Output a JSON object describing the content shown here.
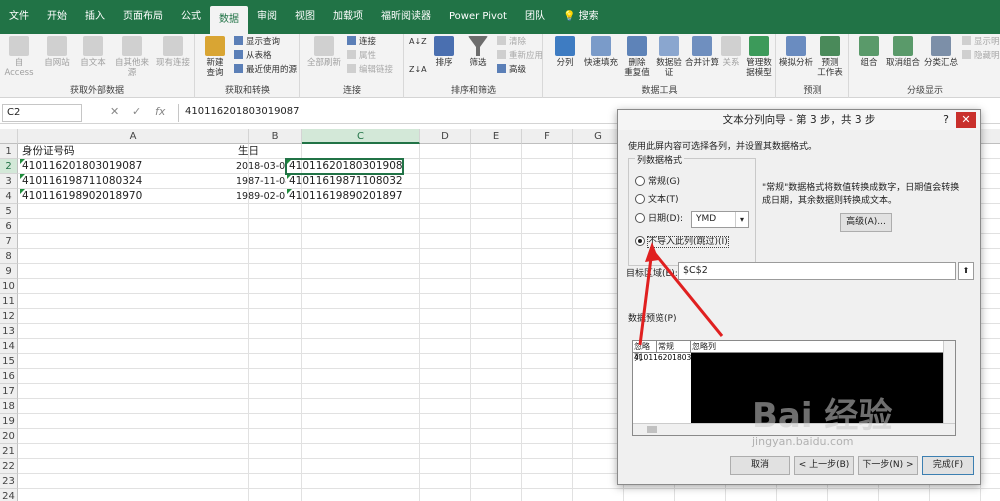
{
  "ribbon_tabs": [
    "文件",
    "开始",
    "插入",
    "页面布局",
    "公式",
    "数据",
    "审阅",
    "视图",
    "加载项",
    "福昕阅读器",
    "Power Pivot",
    "团队",
    "搜索"
  ],
  "active_tab": "数据",
  "groups": {
    "external": {
      "label": "获取外部数据",
      "buttons": [
        "自 Access",
        "自网站",
        "自文本",
        "自其他来源",
        "现有连接"
      ]
    },
    "transform": {
      "label": "获取和转换",
      "new_query": "新建\n查询",
      "show_query": "显示查询",
      "from_table": "从表格",
      "recent_sources": "最近使用的源"
    },
    "connections": {
      "label": "连接",
      "refresh_all": "全部刷新",
      "connections": "连接",
      "properties": "属性",
      "edit_links": "编辑链接"
    },
    "sort_filter": {
      "label": "排序和筛选",
      "sort": "排序",
      "filter": "筛选",
      "clear": "清除",
      "reapply": "重新应用",
      "advanced": "高级"
    },
    "data_tools": {
      "label": "数据工具",
      "buttons": [
        "分列",
        "快速填充",
        "删除\n重复值",
        "数据验\n证",
        "合并计算",
        "关系",
        "管理数\n据模型"
      ]
    },
    "forecast": {
      "label": "预测",
      "buttons": [
        "模拟分析",
        "预测\n工作表"
      ]
    },
    "outline": {
      "label": "分级显示",
      "buttons": [
        "组合",
        "取消组合",
        "分类汇总"
      ],
      "small": [
        "显示明细",
        "隐藏明细"
      ]
    }
  },
  "formula_bar": {
    "name_box": "C2",
    "cancel": "✕",
    "enter": "✓",
    "fx": "fx",
    "formula": "410116201803019087"
  },
  "sheet": {
    "columns": [
      "A",
      "B",
      "C",
      "D",
      "E",
      "F",
      "G",
      "H",
      "I",
      "J",
      "K",
      "L",
      "M",
      "N",
      "O"
    ],
    "rows": [
      "1",
      "2",
      "3",
      "4",
      "5",
      "6",
      "7",
      "8",
      "9",
      "10",
      "11",
      "12",
      "13",
      "14",
      "15",
      "16",
      "17",
      "18",
      "19",
      "20",
      "21",
      "22",
      "23",
      "24",
      "25"
    ],
    "cells": {
      "A1": "身份证号码",
      "B1": "生日",
      "A2": "410116201803019087",
      "B2": "2018-03-01",
      "C2": "410116201803019087",
      "A3": "410116198711080324",
      "B3": "1987-11-08",
      "C3": "410116198711080324",
      "A4": "410116198902018970",
      "B4": "1989-02-01",
      "C4": "410116198902018970"
    }
  },
  "dialog": {
    "title": "文本分列向导 - 第 3 步，共 3 步",
    "help": "?",
    "close": "✕",
    "instruction": "使用此屏内容可选择各列，并设置其数据格式。",
    "format_legend": "列数据格式",
    "options": [
      "常规(G)",
      "文本(T)",
      "日期(D):",
      "不导入此列(跳过)(I)"
    ],
    "selected_option": "不导入此列(跳过)(I)",
    "date_value": "YMD",
    "note": "\"常规\"数据格式将数值转换成数字，日期值会转换成日期，其余数据则转换成文本。",
    "advanced_button": "高级(A)...",
    "destination_label": "目标区域(E):",
    "destination_value": "$C$2",
    "preview_label": "数据预览(P)",
    "preview_headers": [
      "忽略列",
      "常规",
      "忽略列"
    ],
    "preview_rows": [
      "4101162018030190 87"
    ],
    "buttons": [
      "取消",
      "< 上一步(B)",
      "下一步(N) >",
      "完成(F)"
    ]
  },
  "watermark": {
    "brand": "Bai 经验",
    "url": "jingyan.baidu.com"
  },
  "colors": {
    "excel_green": "#217346",
    "annotation_red": "#e02020"
  }
}
